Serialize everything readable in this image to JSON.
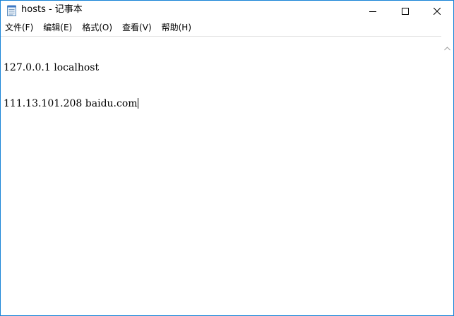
{
  "window": {
    "title": "hosts - 记事本",
    "border_color": "#1883d7"
  },
  "caption_buttons": {
    "minimize_icon": "minimize-icon",
    "maximize_icon": "maximize-icon",
    "close_icon": "close-icon"
  },
  "menu": {
    "items": [
      {
        "label": "文件(F)"
      },
      {
        "label": "编辑(E)"
      },
      {
        "label": "格式(O)"
      },
      {
        "label": "查看(V)"
      },
      {
        "label": "帮助(H)"
      }
    ]
  },
  "editor": {
    "lines": [
      "127.0.0.1 localhost",
      "111.13.101.208 baidu.com"
    ]
  }
}
